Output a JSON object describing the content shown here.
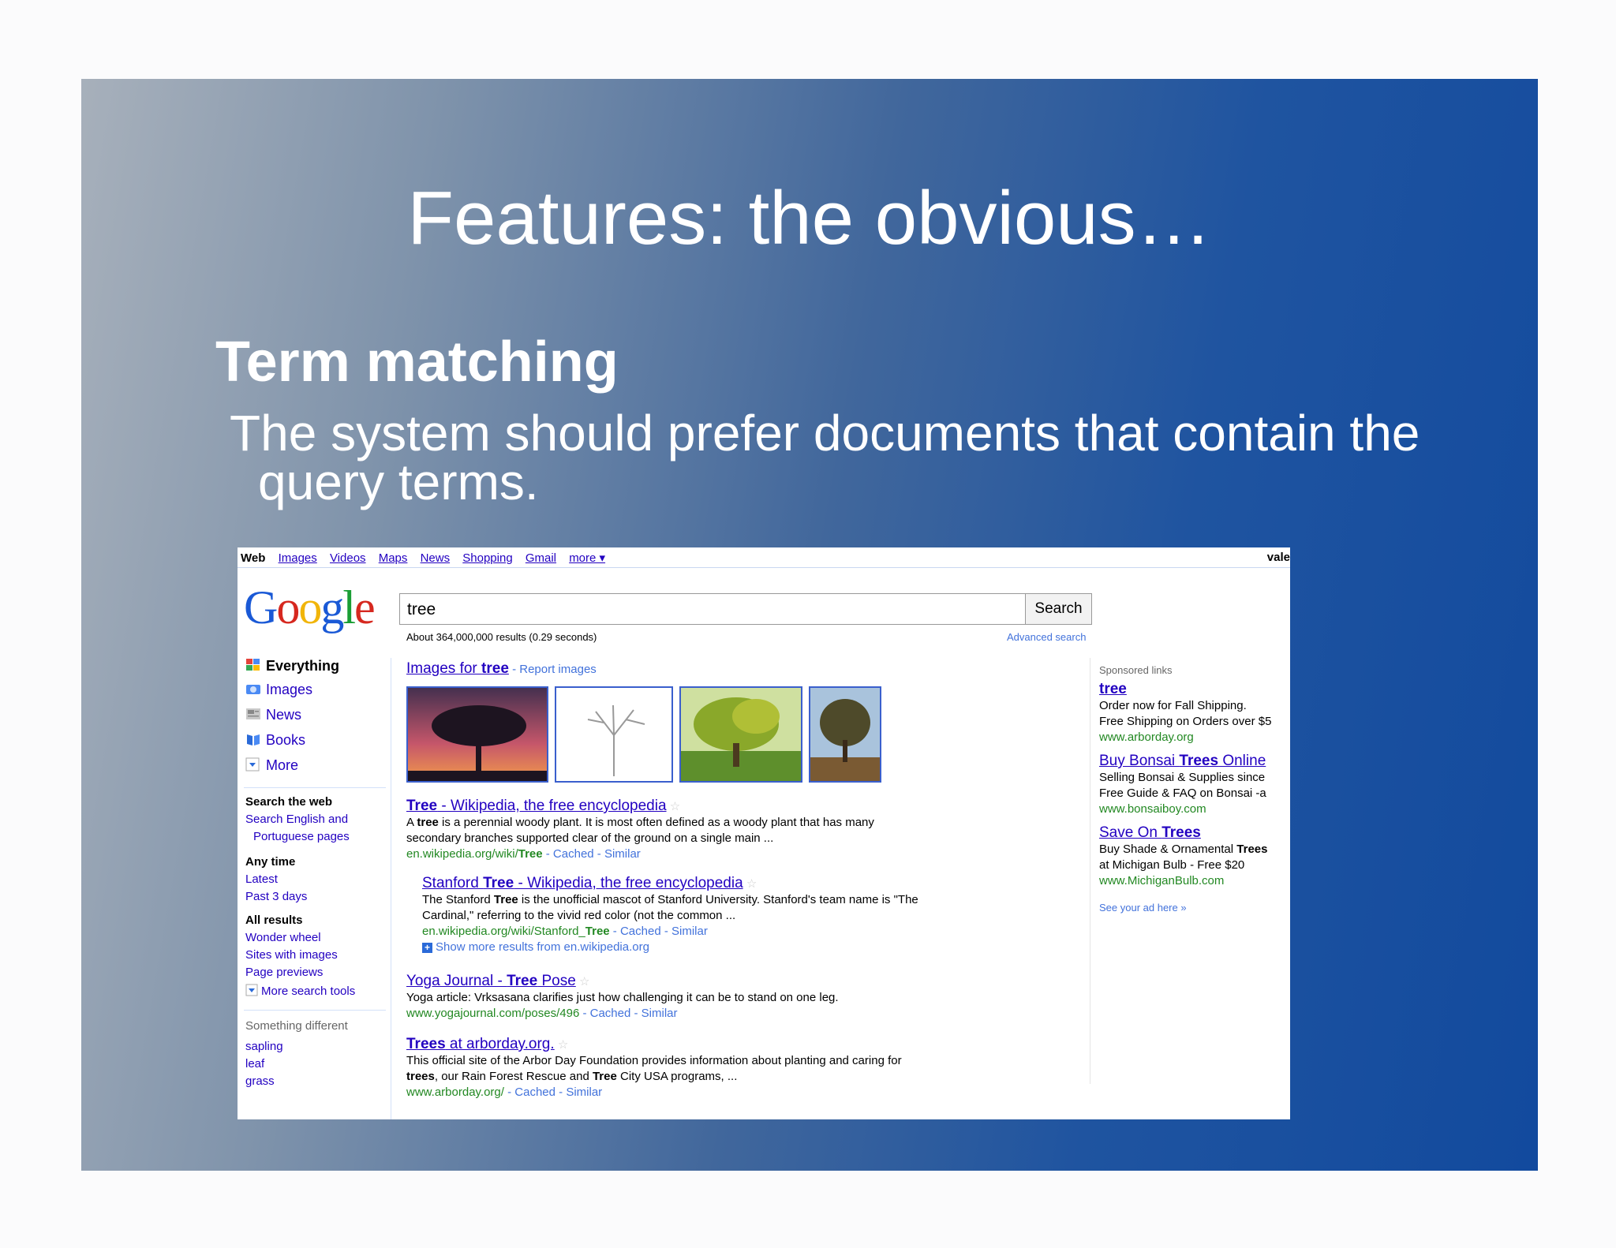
{
  "slide": {
    "title": "Features: the obvious…",
    "bullet_head": "Term matching",
    "bullet_body": "The system should prefer documents that contain the query terms."
  },
  "topnav": {
    "items": [
      "Web",
      "Images",
      "Videos",
      "Maps",
      "News",
      "Shopping",
      "Gmail",
      "more ▾"
    ],
    "user": "vale"
  },
  "search": {
    "query": "tree",
    "button": "Search",
    "stats": "About 364,000,000 results (0.29 seconds)",
    "advanced": "Advanced search"
  },
  "leftnav": {
    "items": [
      "Everything",
      "Images",
      "News",
      "Books",
      "More"
    ],
    "search_web": {
      "heading": "Search the web",
      "link1": "Search English and",
      "link2": "Portuguese pages"
    },
    "any_time": {
      "heading": "Any time",
      "links": [
        "Latest",
        "Past 3 days"
      ]
    },
    "all_results": {
      "heading": "All results",
      "links": [
        "Wonder wheel",
        "Sites with images",
        "Page previews"
      ]
    },
    "more_tools": "More search tools",
    "something_different": {
      "heading": "Something different",
      "links": [
        "sapling",
        "leaf",
        "grass"
      ]
    }
  },
  "images_header": {
    "prefix": "Images for ",
    "term": "tree",
    "report": " - Report images"
  },
  "results": [
    {
      "title_a": "Tree",
      "title_b": " - Wikipedia, the free encyclopedia",
      "snippet_1a": "A ",
      "snippet_1b": "tree",
      "snippet_1c": " is a perennial woody plant. It is most often defined as a woody plant that has many",
      "snippet_2": "secondary branches supported clear of the ground on a single main ...",
      "url_a": "en.wikipedia.org/wiki/",
      "url_b": "Tree",
      "cached": " - Cached - Similar"
    },
    {
      "title_a": "Stanford ",
      "title_b": "Tree",
      "title_c": " - Wikipedia, the free encyclopedia",
      "snippet_1a": "The Stanford ",
      "snippet_1b": "Tree",
      "snippet_1c": " is the unofficial mascot of Stanford University. Stanford's team name is \"The",
      "snippet_2": "Cardinal,\" referring to the vivid red color (not the common ...",
      "url_a": "en.wikipedia.org/wiki/Stanford_",
      "url_b": "Tree",
      "cached": " - Cached - Similar",
      "more": "Show more results from en.wikipedia.org"
    },
    {
      "title_a": "Yoga Journal - ",
      "title_b": "Tree",
      "title_c": " Pose",
      "snippet_1": "Yoga article: Vrksasana clarifies just how challenging it can be to stand on one leg.",
      "url": "www.yogajournal.com/poses/496",
      "cached": " - Cached - Similar"
    },
    {
      "title_a": "Trees",
      "title_b": " at arborday.org.",
      "snippet_1": "This official site of the Arbor Day Foundation provides information about planting and caring for",
      "snippet_2a": "trees",
      "snippet_2b": ", our Rain Forest Rescue and ",
      "snippet_2c": "Tree",
      "snippet_2d": " City USA programs, ...",
      "url": "www.arborday.org/",
      "cached": " - Cached - Similar"
    }
  ],
  "ads": {
    "label": "Sponsored links",
    "items": [
      {
        "title": "tree",
        "line1": "Order now for Fall Shipping.",
        "line2": "Free Shipping on Orders over $5",
        "url": "www.arborday.org"
      },
      {
        "title_a": "Buy Bonsai ",
        "title_b": "Trees",
        "title_c": " Online",
        "line1": "Selling Bonsai & Supplies since",
        "line2": "Free Guide & FAQ on Bonsai -a",
        "url": "www.bonsaiboy.com"
      },
      {
        "title_a": "Save On ",
        "title_b": "Trees",
        "line1a": "Buy Shade & Ornamental ",
        "line1b": "Trees",
        "line2": "at Michigan Bulb - Free $20",
        "url": "www.MichiganBulb.com"
      }
    ],
    "see_your_ad": "See your ad here »"
  },
  "colors": {
    "link": "#2200c1",
    "url": "#228822",
    "secondary_link": "#4272db"
  }
}
